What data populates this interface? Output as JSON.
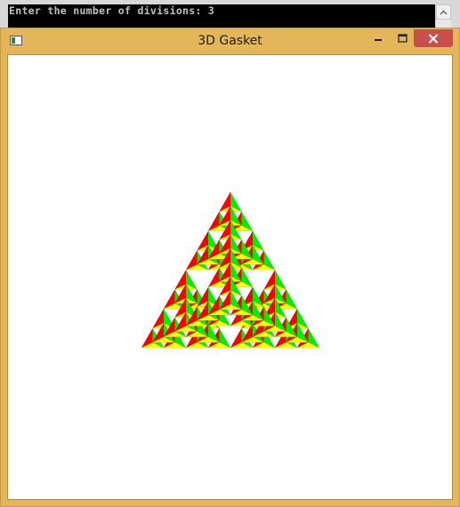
{
  "console": {
    "output_line": "Enter the number of divisions: 3",
    "background_color": "#000000",
    "text_color": "#c0c0c0"
  },
  "window": {
    "title": "3D Gasket",
    "frame_color": "#e2b659",
    "close_button_color": "#c7504d",
    "buttons": {
      "minimize_icon": "minimize-icon",
      "maximize_icon": "maximize-icon",
      "close_icon": "close-icon"
    }
  },
  "gasket": {
    "subdivisions": 3,
    "face_colors": [
      "#ff0000",
      "#00ee00",
      "#0000ff",
      "#ffff00"
    ]
  }
}
